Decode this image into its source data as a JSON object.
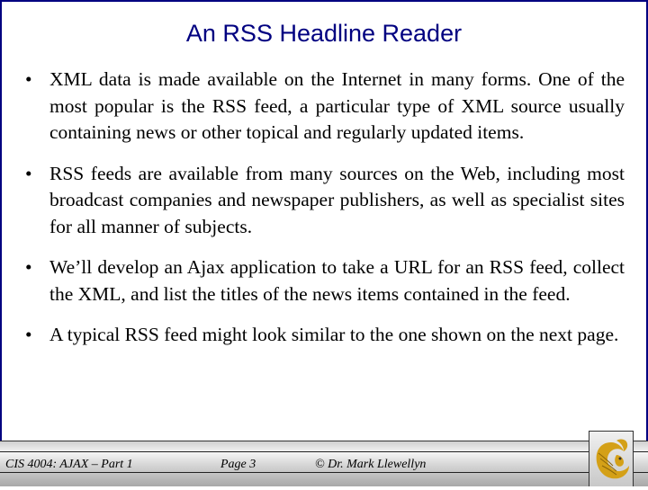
{
  "slide": {
    "title": "An RSS Headline Reader",
    "bullets": [
      {
        "marker": "•",
        "text": "XML data is made available on the Internet in many forms.  One of the most popular is the RSS feed, a particular type of XML source usually containing news or other topical and regularly updated items."
      },
      {
        "marker": "•",
        "text": "RSS feeds are available from many sources on the Web, including most broadcast companies and newspaper publishers, as well as specialist sites for all manner of subjects."
      },
      {
        "marker": "•",
        "text": "We’ll develop an Ajax application to take a URL for an RSS feed, collect the XML, and list the titles of the news items contained in the feed."
      },
      {
        "marker": "•",
        "text": "A typical RSS feed might look similar to the one shown on the next page."
      }
    ]
  },
  "footer": {
    "course": "CIS 4004: AJAX – Part 1",
    "page": "Page 3",
    "copyright": "© Dr. Mark Llewellyn",
    "logo": "pegasus-logo-icon"
  },
  "colors": {
    "title": "#000080",
    "border": "#000080",
    "logo_gold": "#d4a017"
  }
}
